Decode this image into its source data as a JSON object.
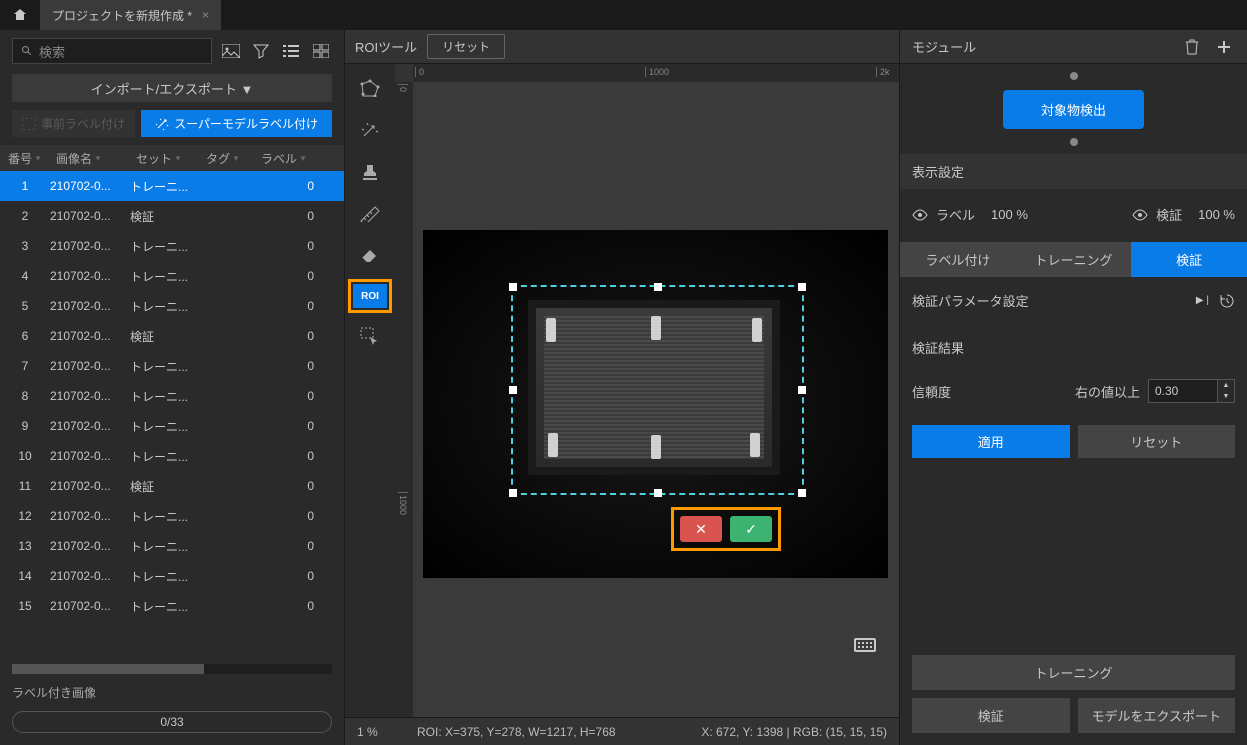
{
  "titlebar": {
    "tab_title": "プロジェクトを新規作成 *"
  },
  "left": {
    "search_placeholder": "検索",
    "import_export": "インポート/エクスポート ▼",
    "prelabel": "事前ラベル付け",
    "supermodel": "スーパーモデルラベル付け",
    "headers": {
      "no": "番号",
      "name": "画像名",
      "set": "セット",
      "tag": "タグ",
      "label": "ラベル"
    },
    "rows": [
      {
        "no": 1,
        "name": "210702-0...",
        "set": "トレーニ...",
        "label": 0,
        "selected": true
      },
      {
        "no": 2,
        "name": "210702-0...",
        "set": "検証",
        "label": 0
      },
      {
        "no": 3,
        "name": "210702-0...",
        "set": "トレーニ...",
        "label": 0
      },
      {
        "no": 4,
        "name": "210702-0...",
        "set": "トレーニ...",
        "label": 0
      },
      {
        "no": 5,
        "name": "210702-0...",
        "set": "トレーニ...",
        "label": 0
      },
      {
        "no": 6,
        "name": "210702-0...",
        "set": "検証",
        "label": 0
      },
      {
        "no": 7,
        "name": "210702-0...",
        "set": "トレーニ...",
        "label": 0
      },
      {
        "no": 8,
        "name": "210702-0...",
        "set": "トレーニ...",
        "label": 0
      },
      {
        "no": 9,
        "name": "210702-0...",
        "set": "トレーニ...",
        "label": 0
      },
      {
        "no": 10,
        "name": "210702-0...",
        "set": "トレーニ...",
        "label": 0
      },
      {
        "no": 11,
        "name": "210702-0...",
        "set": "検証",
        "label": 0
      },
      {
        "no": 12,
        "name": "210702-0...",
        "set": "トレーニ...",
        "label": 0
      },
      {
        "no": 13,
        "name": "210702-0...",
        "set": "トレーニ...",
        "label": 0
      },
      {
        "no": 14,
        "name": "210702-0...",
        "set": "トレーニ...",
        "label": 0
      },
      {
        "no": 15,
        "name": "210702-0...",
        "set": "トレーニ...",
        "label": 0
      }
    ],
    "labeled": "ラベル付き画像",
    "progress": "0/33"
  },
  "center": {
    "toolbar_title": "ROIツール",
    "reset": "リセット",
    "roi_label": "ROI",
    "ruler": {
      "t0": "0",
      "t1000": "1000",
      "t2k": "2k",
      "v0": "0",
      "v1000": "1000"
    },
    "status": {
      "zoom": "1 %",
      "roi": "ROI: X=375, Y=278, W=1217, H=768",
      "cursor": "X: 672, Y: 1398 | RGB: (15, 15, 15)"
    }
  },
  "right": {
    "module": "モジュール",
    "node": "対象物検出",
    "display": "表示設定",
    "label_vis": "ラベル",
    "label_pct": "100 %",
    "verify_vis": "検証",
    "verify_pct": "100 %",
    "tabs": {
      "labeling": "ラベル付け",
      "training": "トレーニング",
      "verify": "検証"
    },
    "param_title": "検証パラメータ設定",
    "result_title": "検証結果",
    "conf_label": "信頼度",
    "conf_cond": "右の値以上",
    "conf_val": "0.30",
    "apply": "適用",
    "reset": "リセット",
    "train_btn": "トレーニング",
    "verify_btn": "検証",
    "export_btn": "モデルをエクスポート"
  }
}
